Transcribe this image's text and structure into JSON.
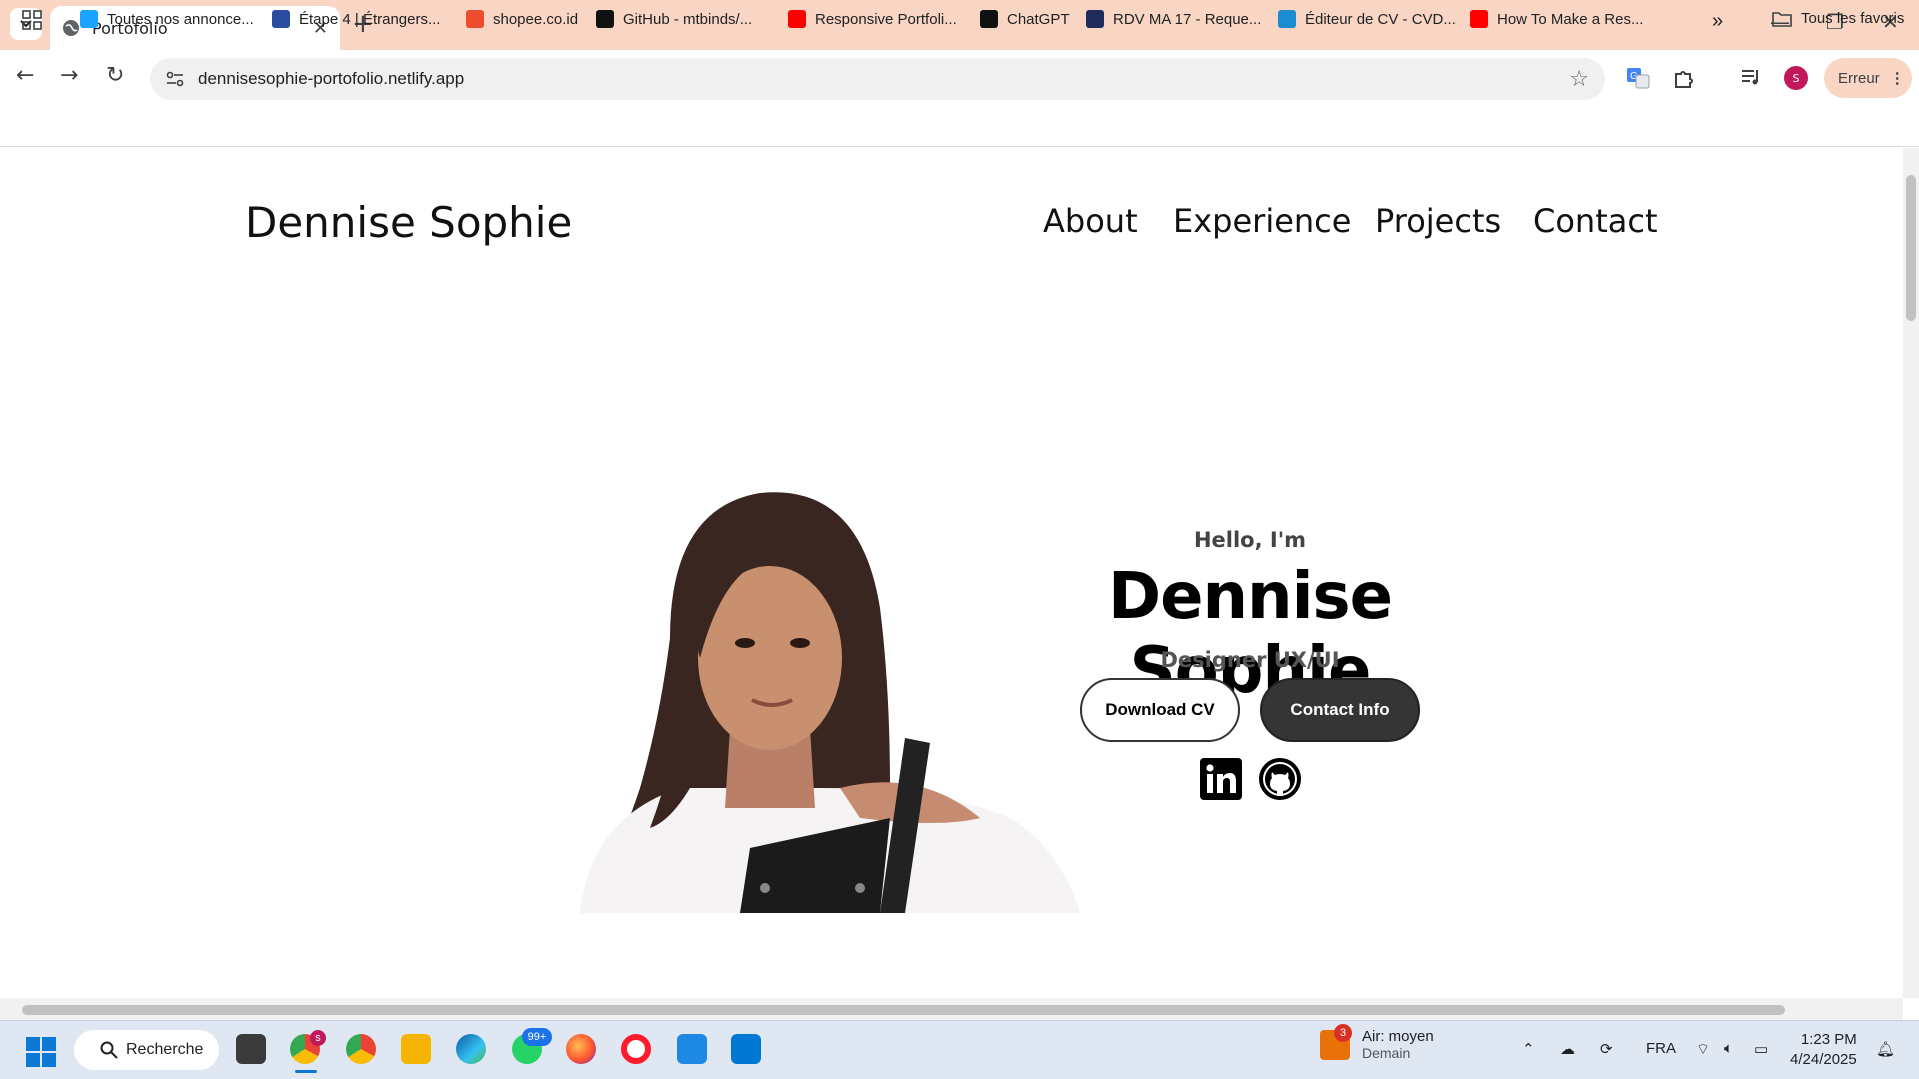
{
  "browser": {
    "tab_title": "Portofolio",
    "url": "dennisesophie-portofolio.netlify.app",
    "profile_initial": "S",
    "error_label": "Erreur"
  },
  "bookmarks": [
    {
      "label": "Toutes nos annonce...",
      "color": "#1aa3ff"
    },
    {
      "label": "Étape 4 | Étrangers...",
      "color": "#2b4ba0"
    },
    {
      "label": "shopee.co.id",
      "color": "#ee4d2d"
    },
    {
      "label": "GitHub - mtbinds/...",
      "color": "#111111"
    },
    {
      "label": "Responsive Portfoli...",
      "color": "#ff0000"
    },
    {
      "label": "ChatGPT",
      "color": "#111111"
    },
    {
      "label": "RDV MA 17 - Reque...",
      "color": "#1f2b5a"
    },
    {
      "label": "Éditeur de CV - CVD...",
      "color": "#1a8ccf"
    },
    {
      "label": "How To Make a Res...",
      "color": "#ff0000"
    }
  ],
  "bookmarks_all": "Tous les favoris",
  "site": {
    "logo": "Dennise Sophie",
    "nav": [
      "About",
      "Experience",
      "Projects",
      "Contact"
    ],
    "hello": "Hello, I'm",
    "name": "Dennise Sophie",
    "role": "Designer UX/UI",
    "btn_cv": "Download CV",
    "btn_contact": "Contact Info"
  },
  "taskbar": {
    "search_label": "Recherche",
    "chrome_badge": "s",
    "whatsapp_badge": "99+",
    "weather_badge": "3",
    "weather_title": "Air: moyen",
    "weather_sub": "Demain",
    "lang": "FRA",
    "time": "1:23 PM",
    "date": "4/24/2025"
  }
}
